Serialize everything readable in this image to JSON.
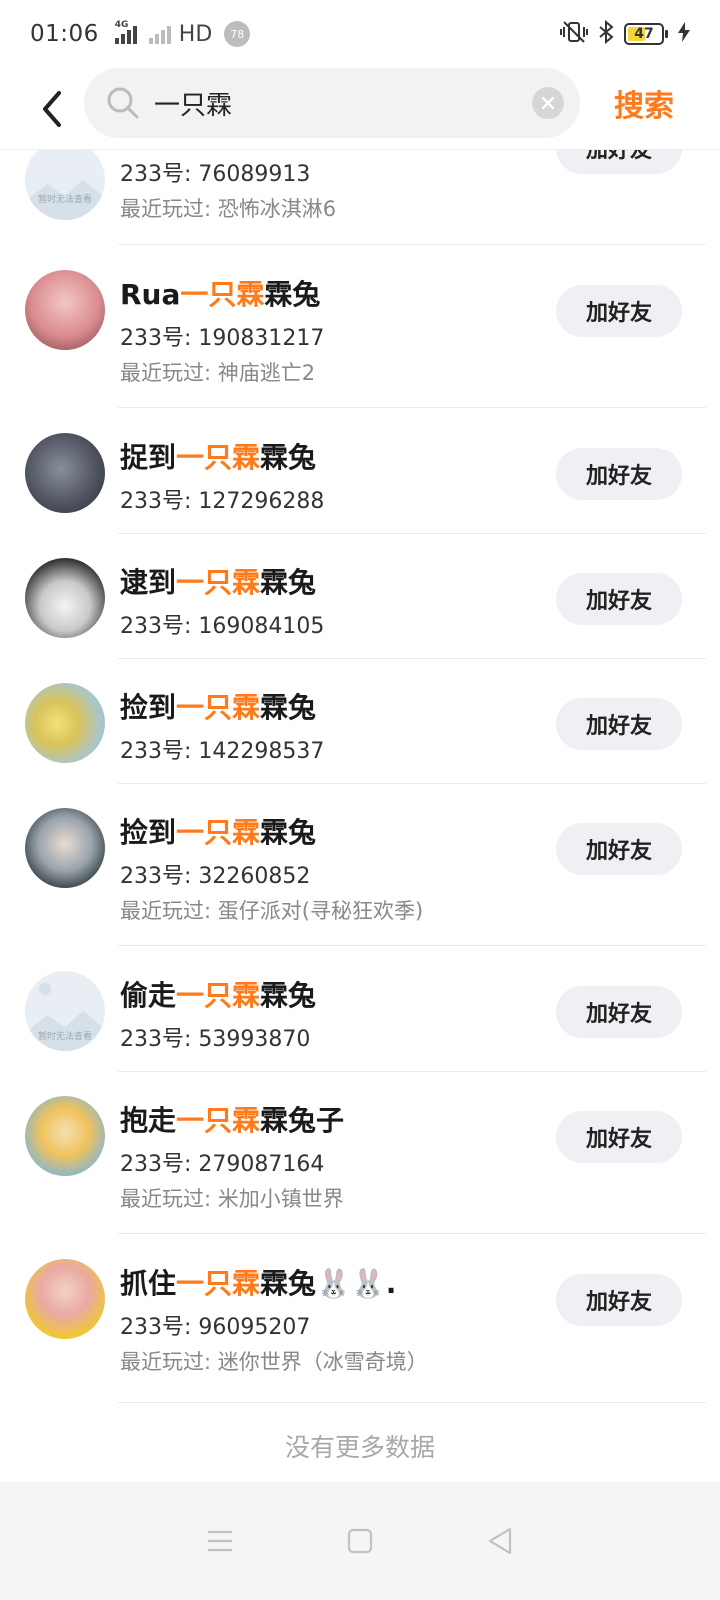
{
  "status_bar": {
    "time": "01:06",
    "network_label": "4G",
    "hd_label": "HD",
    "notification_count": "78",
    "battery_level": "47"
  },
  "search": {
    "query": "一只霖",
    "submit_label": "搜索"
  },
  "results": [
    {
      "prefix": "",
      "highlight": "",
      "suffix": "",
      "uid": "233号: 76089913",
      "played": "最近玩过: 恐怖冰淇淋6",
      "button": "加好友"
    },
    {
      "prefix": "Rua",
      "highlight": "一只霖",
      "suffix": "霖兔",
      "uid": "233号: 190831217",
      "played": "最近玩过: 神庙逃亡2",
      "button": "加好友"
    },
    {
      "prefix": "捉到",
      "highlight": "一只霖",
      "suffix": "霖兔",
      "uid": "233号: 127296288",
      "played": "",
      "button": "加好友"
    },
    {
      "prefix": "逮到",
      "highlight": "一只霖",
      "suffix": "霖兔",
      "uid": "233号: 169084105",
      "played": "",
      "button": "加好友"
    },
    {
      "prefix": "捡到",
      "highlight": "一只霖",
      "suffix": "霖兔",
      "uid": "233号: 142298537",
      "played": "",
      "button": "加好友"
    },
    {
      "prefix": "捡到",
      "highlight": "一只霖",
      "suffix": "霖兔",
      "uid": "233号: 32260852",
      "played": "最近玩过: 蛋仔派对(寻秘狂欢季)",
      "button": "加好友"
    },
    {
      "prefix": "偷走",
      "highlight": "一只霖",
      "suffix": "霖兔",
      "uid": "233号: 53993870",
      "played": "",
      "button": "加好友"
    },
    {
      "prefix": "抱走",
      "highlight": "一只霖",
      "suffix": "霖兔子",
      "uid": "233号: 279087164",
      "played": "最近玩过: 米加小镇世界",
      "button": "加好友"
    },
    {
      "prefix": "抓住",
      "highlight": "一只霖",
      "suffix": "霖兔🐰🐰.",
      "uid": "233号: 96095207",
      "played": "最近玩过: 迷你世界（冰雪奇境）",
      "button": "加好友"
    }
  ],
  "avatar_placeholder_text": "暂时无法查看",
  "footer": {
    "no_more": "没有更多数据"
  },
  "colors": {
    "accent": "#ff7a1a",
    "button_bg": "#eff0f4"
  },
  "icons": [
    "back-arrow-icon",
    "search-icon",
    "clear-icon",
    "menu-icon",
    "home-icon",
    "back-triangle-icon"
  ]
}
